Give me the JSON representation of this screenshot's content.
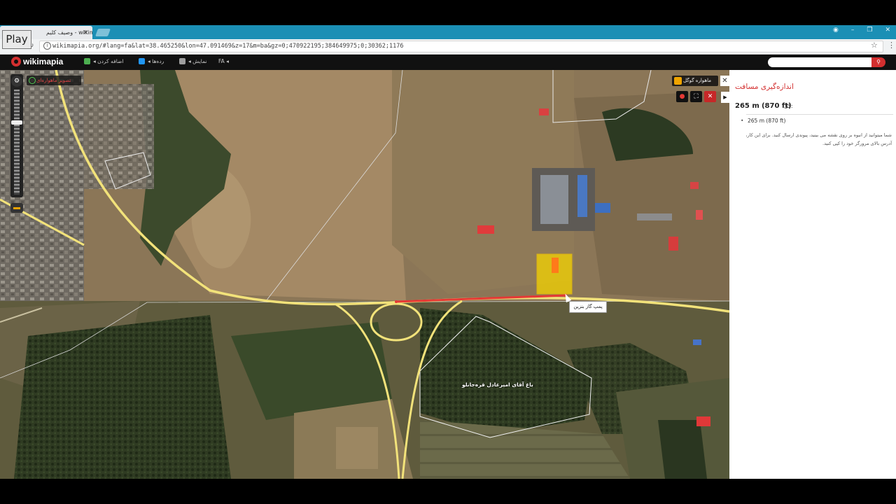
{
  "browser": {
    "tab_title": "وصیف کلیم - wikimapia",
    "tab_close": "×",
    "url": "wikimapia.org/#lang=fa&lat=38.465250&lon=47.091469&z=17&m=ba&gz=0;470922195;384649975;0;30362;1176",
    "play_label": "Play",
    "window_controls": [
      "◉",
      "–",
      "❐",
      "✕"
    ]
  },
  "wm_header": {
    "logo_text": "wikimapia",
    "menu": [
      {
        "label": "◂ اضافه کردن",
        "color": "#4caf50"
      },
      {
        "label": "◂ رده‌ها",
        "color": "#2196f3"
      },
      {
        "label": "◂ نمایش",
        "color": "#9e9e9e"
      },
      {
        "label": "FA ◂",
        "color": ""
      }
    ],
    "search_icon": "search-icon"
  },
  "map": {
    "layer_chip": "تصویر ماهواره‌ای",
    "ruler_chip": "ماهواره گوگل",
    "ruler_close": "✕",
    "tools": [
      "●",
      "⛶",
      "✕"
    ],
    "tooltip": "پمپ گاز بنزین",
    "place_label": "باغ آقای امیرعادل قره‌جانلو",
    "highlight_color": "#f5d400",
    "measure_line_color": "#e53935"
  },
  "panel": {
    "title": "اندازه‌گیری مسافت",
    "total_value": "265 m",
    "total_ft": "(870 ft)",
    "total_label": "کل:",
    "segment": "265 m (870 ft)",
    "help_text": "شما میتوانید از انبوه بر روی نقشه می بینید، پیوندی ارسال کنید. برای این کار، آدرس بالای مرورگر خود را کپی کنید."
  }
}
